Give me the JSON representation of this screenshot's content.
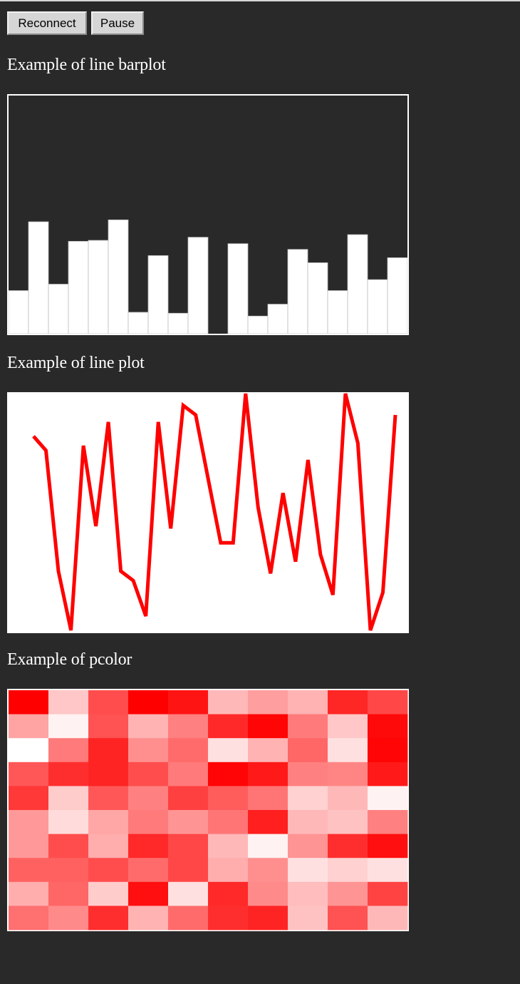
{
  "toolbar": {
    "reconnect_label": "Reconnect",
    "pause_label": "Pause"
  },
  "headings": {
    "barplot": "Example of line barplot",
    "lineplot": "Example of line plot",
    "pcolor": "Example of pcolor"
  },
  "colors": {
    "page_background": "#292929",
    "bar_fill": "#ffffff",
    "bar_divider": "#bdbdbd",
    "line_stroke": "#ff0000",
    "heat_high": "#ff0000",
    "heat_low": "#ffffff"
  },
  "chart_data": [
    {
      "type": "bar",
      "values": [
        0.181,
        0.47,
        0.208,
        0.388,
        0.392,
        0.478,
        0.09,
        0.328,
        0.086,
        0.405,
        0.0,
        0.378,
        0.074,
        0.124,
        0.354,
        0.298,
        0.181,
        0.416,
        0.227,
        0.319
      ],
      "ylim": [
        0,
        1
      ],
      "grid": false,
      "legend": "none"
    },
    {
      "type": "line",
      "values": [
        0.82,
        0.76,
        0.25,
        0.0,
        0.78,
        0.44,
        0.88,
        0.25,
        0.21,
        0.06,
        0.88,
        0.43,
        0.95,
        0.91,
        0.64,
        0.37,
        0.37,
        1.0,
        0.52,
        0.24,
        0.58,
        0.29,
        0.72,
        0.32,
        0.15,
        1.0,
        0.79,
        0.0,
        0.16,
        0.91
      ],
      "ylim": [
        0,
        1
      ],
      "grid": false,
      "legend": "none"
    },
    {
      "type": "heatmap",
      "rows": 10,
      "cols": 10,
      "values": [
        [
          1.0,
          0.22,
          0.7,
          1.0,
          0.92,
          0.28,
          0.38,
          0.3,
          0.85,
          0.72
        ],
        [
          0.36,
          0.05,
          0.68,
          0.3,
          0.5,
          0.84,
          0.98,
          0.52,
          0.22,
          0.96
        ],
        [
          0.0,
          0.52,
          0.86,
          0.44,
          0.58,
          0.12,
          0.3,
          0.6,
          0.12,
          0.98
        ],
        [
          0.66,
          0.82,
          0.86,
          0.7,
          0.52,
          0.98,
          0.9,
          0.5,
          0.48,
          0.9
        ],
        [
          0.78,
          0.2,
          0.66,
          0.5,
          0.75,
          0.64,
          0.54,
          0.18,
          0.28,
          0.05
        ],
        [
          0.4,
          0.14,
          0.35,
          0.52,
          0.42,
          0.54,
          0.88,
          0.28,
          0.24,
          0.5
        ],
        [
          0.4,
          0.7,
          0.32,
          0.84,
          0.72,
          0.28,
          0.05,
          0.42,
          0.82,
          0.94
        ],
        [
          0.62,
          0.62,
          0.7,
          0.58,
          0.72,
          0.32,
          0.44,
          0.12,
          0.18,
          0.12
        ],
        [
          0.32,
          0.6,
          0.2,
          0.94,
          0.12,
          0.84,
          0.46,
          0.26,
          0.42,
          0.74
        ],
        [
          0.56,
          0.46,
          0.82,
          0.3,
          0.58,
          0.82,
          0.86,
          0.24,
          0.68,
          0.28
        ]
      ],
      "vlim": [
        0,
        1
      ],
      "grid": false,
      "legend": "none"
    }
  ]
}
